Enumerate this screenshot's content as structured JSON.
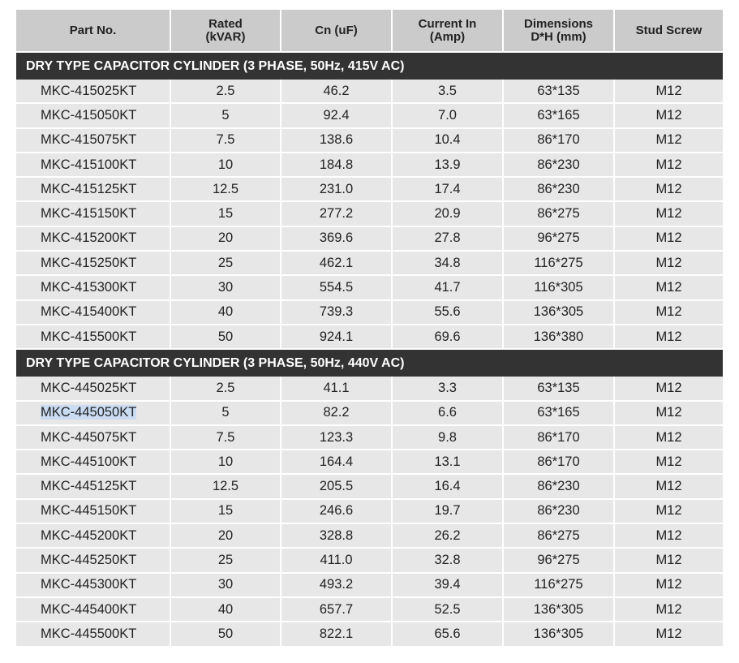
{
  "columns": [
    {
      "line1": "Part No.",
      "line2": ""
    },
    {
      "line1": "Rated",
      "line2": "(kVAR)"
    },
    {
      "line1": "Cn (uF)",
      "line2": ""
    },
    {
      "line1": "Current In",
      "line2": "(Amp)"
    },
    {
      "line1": "Dimensions",
      "line2": "D*H (mm)"
    },
    {
      "line1": "Stud Screw",
      "line2": ""
    }
  ],
  "sections": [
    {
      "title": "DRY TYPE CAPACITOR CYLINDER (3 PHASE, 50Hz, 415V AC)",
      "rows": [
        [
          "MKC-415025KT",
          "2.5",
          "46.2",
          "3.5",
          "63*135",
          "M12"
        ],
        [
          "MKC-415050KT",
          "5",
          "92.4",
          "7.0",
          "63*165",
          "M12"
        ],
        [
          "MKC-415075KT",
          "7.5",
          "138.6",
          "10.4",
          "86*170",
          "M12"
        ],
        [
          "MKC-415100KT",
          "10",
          "184.8",
          "13.9",
          "86*230",
          "M12"
        ],
        [
          "MKC-415125KT",
          "12.5",
          "231.0",
          "17.4",
          "86*230",
          "M12"
        ],
        [
          "MKC-415150KT",
          "15",
          "277.2",
          "20.9",
          "86*275",
          "M12"
        ],
        [
          "MKC-415200KT",
          "20",
          "369.6",
          "27.8",
          "96*275",
          "M12"
        ],
        [
          "MKC-415250KT",
          "25",
          "462.1",
          "34.8",
          "116*275",
          "M12"
        ],
        [
          "MKC-415300KT",
          "30",
          "554.5",
          "41.7",
          "116*305",
          "M12"
        ],
        [
          "MKC-415400KT",
          "40",
          "739.3",
          "55.6",
          "136*305",
          "M12"
        ],
        [
          "MKC-415500KT",
          "50",
          "924.1",
          "69.6",
          "136*380",
          "M12"
        ]
      ]
    },
    {
      "title": "DRY TYPE CAPACITOR CYLINDER (3 PHASE, 50Hz, 440V AC)",
      "rows": [
        [
          "MKC-445025KT",
          "2.5",
          "41.1",
          "3.3",
          "63*135",
          "M12"
        ],
        [
          "MKC-445050KT",
          "5",
          "82.2",
          "6.6",
          "63*165",
          "M12"
        ],
        [
          "MKC-445075KT",
          "7.5",
          "123.3",
          "9.8",
          "86*170",
          "M12"
        ],
        [
          "MKC-445100KT",
          "10",
          "164.4",
          "13.1",
          "86*170",
          "M12"
        ],
        [
          "MKC-445125KT",
          "12.5",
          "205.5",
          "16.4",
          "86*230",
          "M12"
        ],
        [
          "MKC-445150KT",
          "15",
          "246.6",
          "19.7",
          "86*230",
          "M12"
        ],
        [
          "MKC-445200KT",
          "20",
          "328.8",
          "26.2",
          "86*275",
          "M12"
        ],
        [
          "MKC-445250KT",
          "25",
          "411.0",
          "32.8",
          "96*275",
          "M12"
        ],
        [
          "MKC-445300KT",
          "30",
          "493.2",
          "39.4",
          "116*275",
          "M12"
        ],
        [
          "MKC-445400KT",
          "40",
          "657.7",
          "52.5",
          "136*305",
          "M12"
        ],
        [
          "MKC-445500KT",
          "50",
          "822.1",
          "65.6",
          "136*305",
          "M12"
        ]
      ]
    }
  ],
  "highlighted_part": "MKC-445050KT"
}
